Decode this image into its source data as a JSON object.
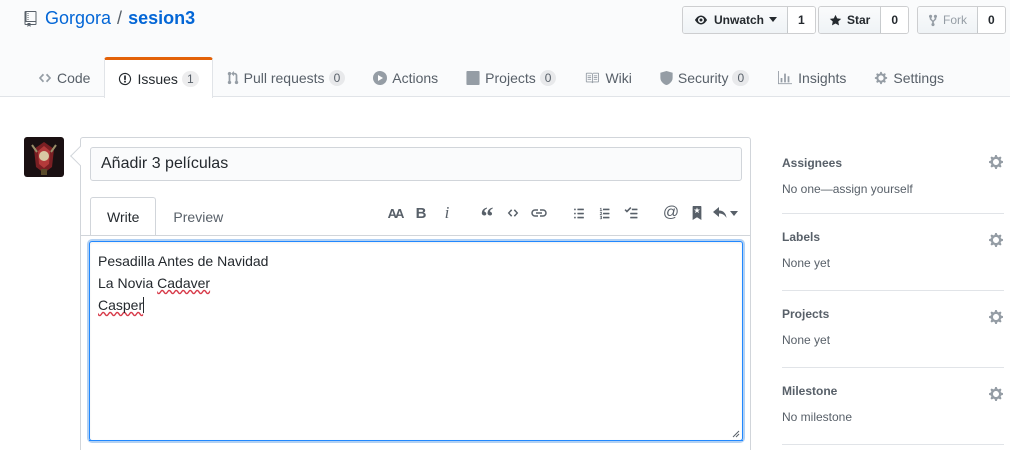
{
  "repo": {
    "owner": "Gorgora",
    "separator": "/",
    "name": "sesion3"
  },
  "actions": {
    "watch": {
      "label": "Unwatch",
      "count": "1"
    },
    "star": {
      "label": "Star",
      "count": "0"
    },
    "fork": {
      "label": "Fork",
      "count": "0"
    }
  },
  "tabs": [
    {
      "label": "Code",
      "icon": "code-icon"
    },
    {
      "label": "Issues",
      "icon": "issue-icon",
      "counter": "1",
      "selected": true
    },
    {
      "label": "Pull requests",
      "icon": "pull-request-icon",
      "counter": "0"
    },
    {
      "label": "Actions",
      "icon": "play-icon"
    },
    {
      "label": "Projects",
      "icon": "project-icon",
      "counter": "0"
    },
    {
      "label": "Wiki",
      "icon": "book-icon"
    },
    {
      "label": "Security",
      "icon": "shield-icon",
      "counter": "0"
    },
    {
      "label": "Insights",
      "icon": "graph-icon"
    },
    {
      "label": "Settings",
      "icon": "gear-icon"
    }
  ],
  "issue_form": {
    "title_value": "Añadir 3 películas",
    "write_tab": "Write",
    "preview_tab": "Preview",
    "toolbar_text_size": "AA",
    "toolbar_bold": "B",
    "toolbar_italic": "i",
    "toolbar_quote": "“",
    "toolbar_mention": "@",
    "body_lines": [
      "Pesadilla Antes de Navidad",
      "La Novia ",
      "Cadaver",
      "Casper"
    ]
  },
  "sidebar": {
    "assignees": {
      "heading": "Assignees",
      "value": "No one—assign yourself"
    },
    "labels": {
      "heading": "Labels",
      "value": "None yet"
    },
    "projects": {
      "heading": "Projects",
      "value": "None yet"
    },
    "milestone": {
      "heading": "Milestone",
      "value": "No milestone"
    }
  },
  "colors": {
    "link": "#0366d6",
    "tab_accent": "#e36209",
    "focus": "#2188ff"
  }
}
